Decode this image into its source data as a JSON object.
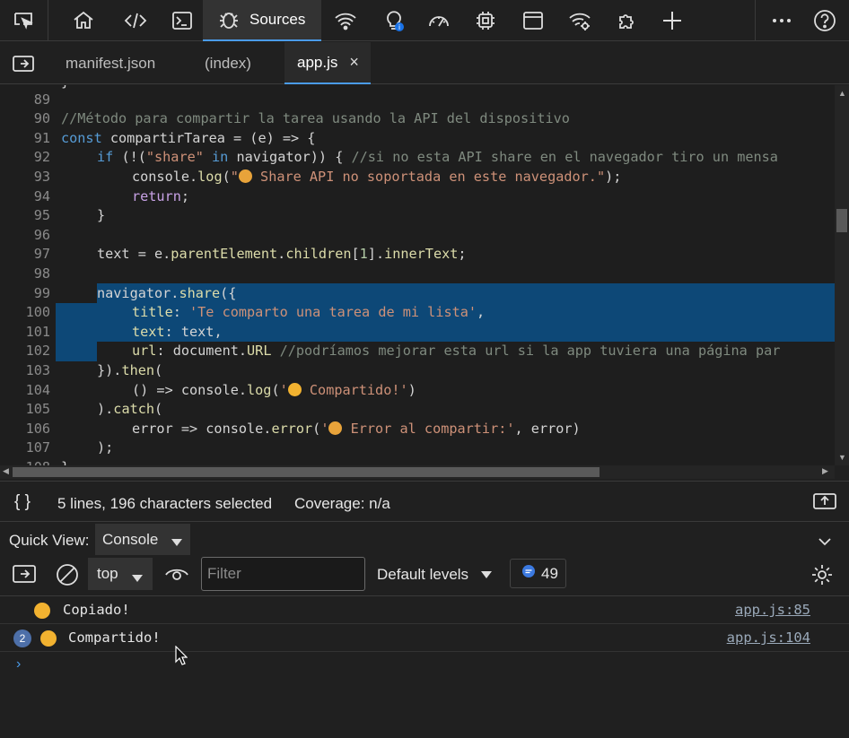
{
  "toolbar": {
    "icons": [
      "inspect-icon",
      "home-icon",
      "elements-icon",
      "console-icon",
      "sources-icon",
      "network-icon",
      "performance-icon",
      "speed-icon",
      "memory-icon",
      "application-icon",
      "network-conditions-icon",
      "extensions-icon",
      "plus-icon",
      "more-icon",
      "help-icon"
    ],
    "active_tab": "Sources"
  },
  "file_tabs": [
    {
      "label": "manifest.json"
    },
    {
      "label": "(index)"
    },
    {
      "label": "app.js",
      "close": "×"
    }
  ],
  "editor": {
    "lines": [
      {
        "n": "89"
      },
      {
        "n": "90"
      },
      {
        "n": "91"
      },
      {
        "n": "92"
      },
      {
        "n": "93"
      },
      {
        "n": "94"
      },
      {
        "n": "95"
      },
      {
        "n": "96"
      },
      {
        "n": "97"
      },
      {
        "n": "98"
      },
      {
        "n": "99"
      },
      {
        "n": "100"
      },
      {
        "n": "101"
      },
      {
        "n": "102"
      },
      {
        "n": "103"
      },
      {
        "n": "104"
      },
      {
        "n": "105"
      },
      {
        "n": "106"
      },
      {
        "n": "107"
      },
      {
        "n": "108"
      }
    ],
    "l89": "}",
    "l90": "//Método para compartir la tarea usando la API del dispositivo",
    "l91_kw": "const",
    "l91_rest": " compartirTarea = (e) => {",
    "l92_kw": "if",
    "l92_a": " (!(",
    "l92_s": "\"share\"",
    "l92_in": " in",
    "l92_b": " navigator)) { ",
    "l92_c": "//si no esta API share en el navegador tiro un mensa",
    "l93_a": "console.",
    "l93_f": "log",
    "l93_b": "(",
    "l93_s1": "\"",
    "l93_s2": " Share API no soportada en este navegador.\"",
    "l93_c": ");",
    "l94_kw": "return",
    "l94_b": ";",
    "l95": "}",
    "l97_a": "text = e.",
    "l97_p1": "parentElement",
    "l97_b": ".",
    "l97_p2": "children",
    "l97_c": "[",
    "l97_n": "1",
    "l97_d": "].",
    "l97_p3": "innerText",
    "l97_e": ";",
    "l99_a": "navigator.",
    "l99_f": "share",
    "l99_b": "({",
    "l100_p": "title",
    "l100_a": ": ",
    "l100_s": "'Te comparto una tarea de mi lista'",
    "l100_b": ",",
    "l101_p": "text",
    "l101_a": ": text,",
    "l102_p": "url",
    "l102_a": ": document.",
    "l102_u": "URL",
    "l102_c": " //podríamos mejorar esta url si la app tuviera una página par",
    "l103_a": "})",
    "l103_b": ".",
    "l103_f": "then",
    "l103_c": "(",
    "l104_a": "() => console.",
    "l104_f": "log",
    "l104_b": "(",
    "l104_s1": "'",
    "l104_s2": " Compartido!'",
    "l104_c": ")",
    "l105_a": ").",
    "l105_f": "catch",
    "l105_b": "(",
    "l106_a": "error => console.",
    "l106_f": "error",
    "l106_b": "(",
    "l106_s1": "'",
    "l106_s2": " Error al compartir:'",
    "l106_c": ", error)",
    "l107": ");",
    "l108": "}"
  },
  "status": {
    "braces": "{ }",
    "selection": "5 lines, 196 characters selected",
    "coverage": "Coverage: n/a"
  },
  "quick_view": {
    "label": "Quick View:",
    "selected": "Console"
  },
  "console_toolbar": {
    "context": "top",
    "filter_placeholder": "Filter",
    "levels": "Default levels",
    "issues_count": "49"
  },
  "messages": [
    {
      "text": "Copiado!",
      "source": "app.js:85",
      "repeat": ""
    },
    {
      "text": "Compartido!",
      "source": "app.js:104",
      "repeat": "2"
    }
  ],
  "colors": {
    "accent": "#4a9be8",
    "selection": "#0d4877",
    "string": "#ce9178",
    "keyword": "#569cd6",
    "comment": "#7f8a7f"
  }
}
